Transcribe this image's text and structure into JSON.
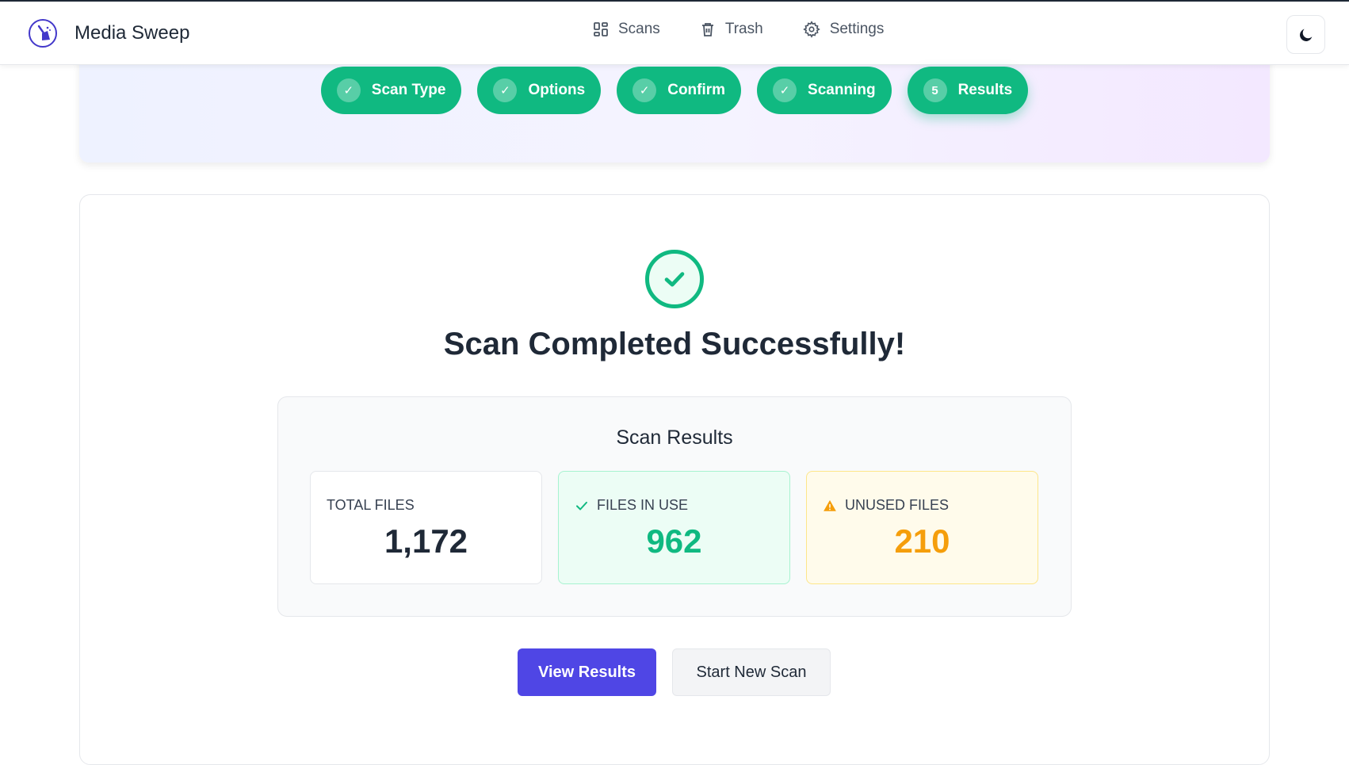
{
  "app": {
    "name": "Media Sweep"
  },
  "nav": {
    "items": [
      {
        "label": "Scans",
        "icon": "grid-icon"
      },
      {
        "label": "Trash",
        "icon": "trash-icon"
      },
      {
        "label": "Settings",
        "icon": "gear-icon"
      }
    ],
    "theme_icon": "moon-icon"
  },
  "steps": [
    {
      "marker": "✓",
      "label": "Scan Type",
      "status": "complete"
    },
    {
      "marker": "✓",
      "label": "Options",
      "status": "complete"
    },
    {
      "marker": "✓",
      "label": "Confirm",
      "status": "complete"
    },
    {
      "marker": "✓",
      "label": "Scanning",
      "status": "complete"
    },
    {
      "marker": "5",
      "label": "Results",
      "status": "active"
    }
  ],
  "result": {
    "title": "Scan Completed Successfully!",
    "section_title": "Scan Results",
    "stats": {
      "total": {
        "label": "Total Files",
        "value": "1,172"
      },
      "in_use": {
        "label": "Files in Use",
        "value": "962"
      },
      "unused": {
        "label": "Unused Files",
        "value": "210"
      }
    }
  },
  "actions": {
    "view_results": "View Results",
    "new_scan": "Start New Scan"
  },
  "colors": {
    "accent": "#4f46e5",
    "success": "#10b981",
    "warning": "#f59e0b"
  }
}
